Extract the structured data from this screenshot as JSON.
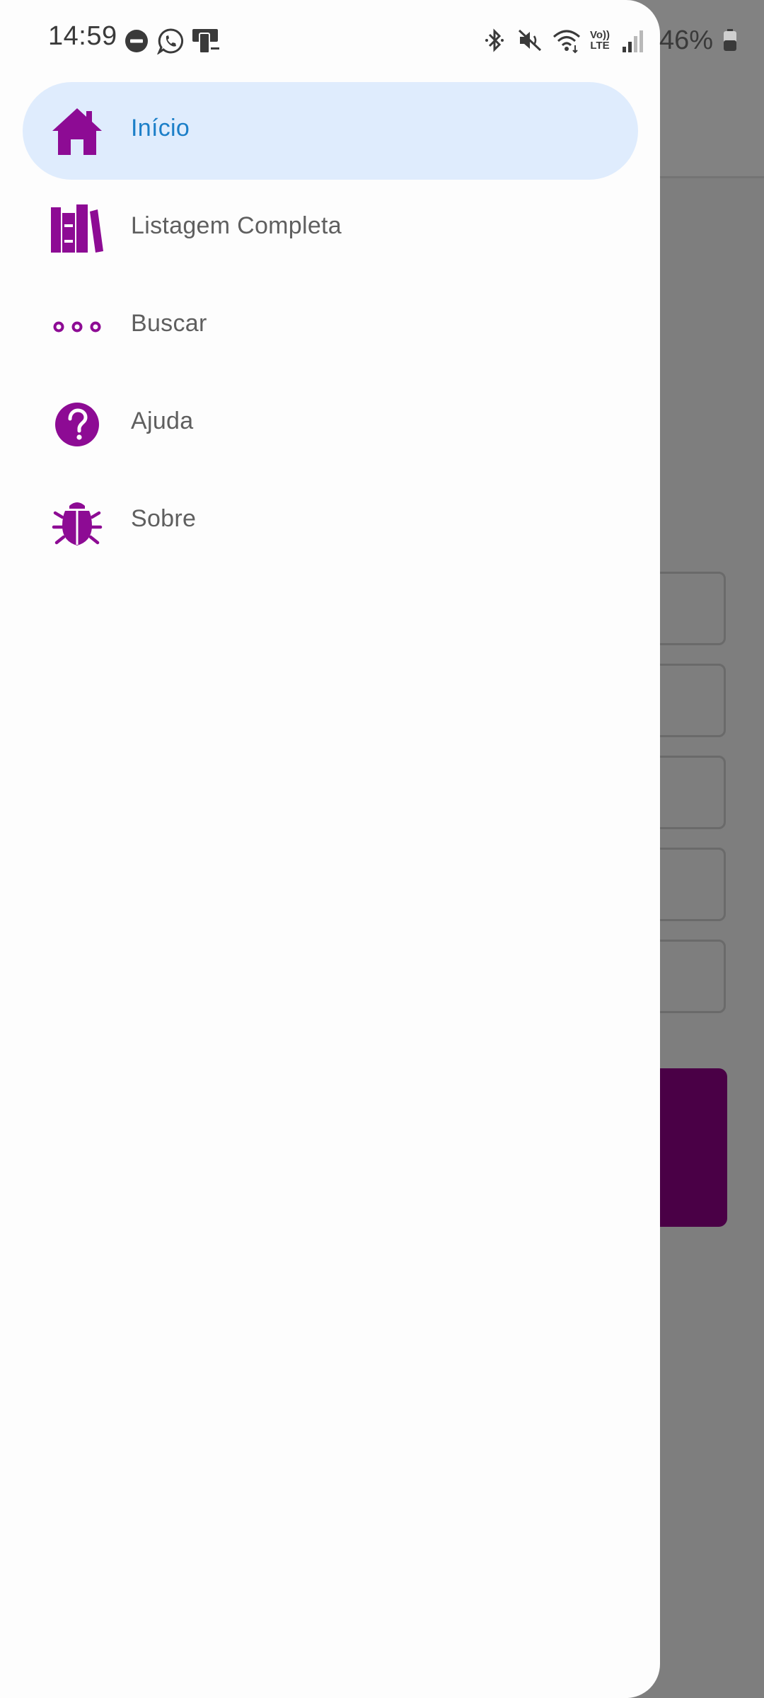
{
  "status_bar": {
    "time": "14:59",
    "left_icons": [
      "do-not-disturb-icon",
      "whatsapp-icon",
      "phone-device-icon"
    ],
    "right_icons": [
      "bluetooth-icon",
      "mute-icon",
      "wifi-icon",
      "volte-icon",
      "signal-icon",
      "battery-icon"
    ],
    "volte_label_top": "Vo))",
    "volte_label_bottom": "LTE",
    "battery_percent": "46%"
  },
  "drawer": {
    "accent_color": "#8d0b94",
    "active_bg": "#dfecfd",
    "active_text_color": "#1c7fc8",
    "items": [
      {
        "label": "Início",
        "icon": "home-icon",
        "active": true
      },
      {
        "label": "Listagem Completa",
        "icon": "books-icon",
        "active": false
      },
      {
        "label": "Buscar",
        "icon": "more-dots-icon",
        "active": false
      },
      {
        "label": "Ajuda",
        "icon": "help-circle-icon",
        "active": false
      },
      {
        "label": "Sobre",
        "icon": "bug-icon",
        "active": false
      }
    ]
  }
}
